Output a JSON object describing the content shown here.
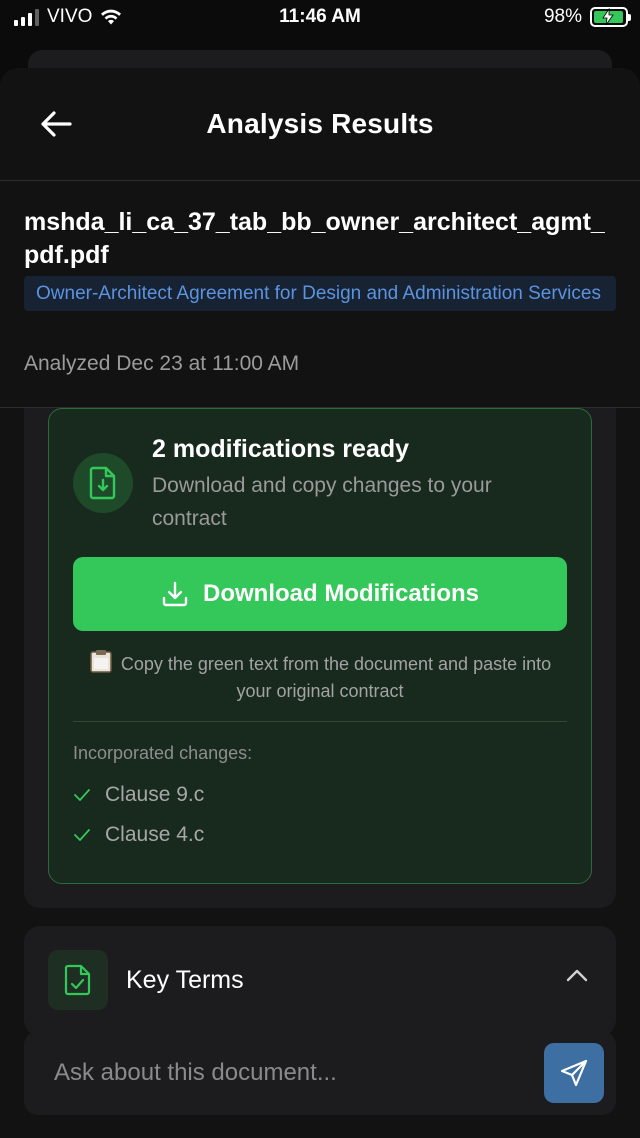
{
  "status_bar": {
    "carrier": "VIVO",
    "time": "11:46 AM",
    "battery_percent": "98%",
    "battery_level": 0.98,
    "battery_color": "#34c759"
  },
  "header": {
    "back_icon": "arrow-left-icon",
    "title": "Analysis Results"
  },
  "document": {
    "filename": "mshda_li_ca_37_tab_bb_owner_architect_agmt_pdf.pdf",
    "type": "Owner-Architect Agreement for Design and Administration Services",
    "analyzed": "Analyzed Dec 23 at 11:00 AM"
  },
  "modifications": {
    "icon": "file-download-icon",
    "title": "2 modifications ready",
    "subtitle": "Download and copy changes to your contract",
    "download_label": "Download Modifications",
    "copy_hint": "Copy the green text from the document and paste into your original contract",
    "incorporated_label": "Incorporated changes:",
    "changes": [
      "Clause 9.c",
      "Clause 4.c"
    ],
    "accent": "#34c759"
  },
  "key_terms": {
    "icon": "file-check-icon",
    "label": "Key Terms",
    "chevron": "chevron-up-icon"
  },
  "ask": {
    "placeholder": "Ask about this document...",
    "send_icon": "send-icon",
    "send_color": "#3d6fa3"
  }
}
